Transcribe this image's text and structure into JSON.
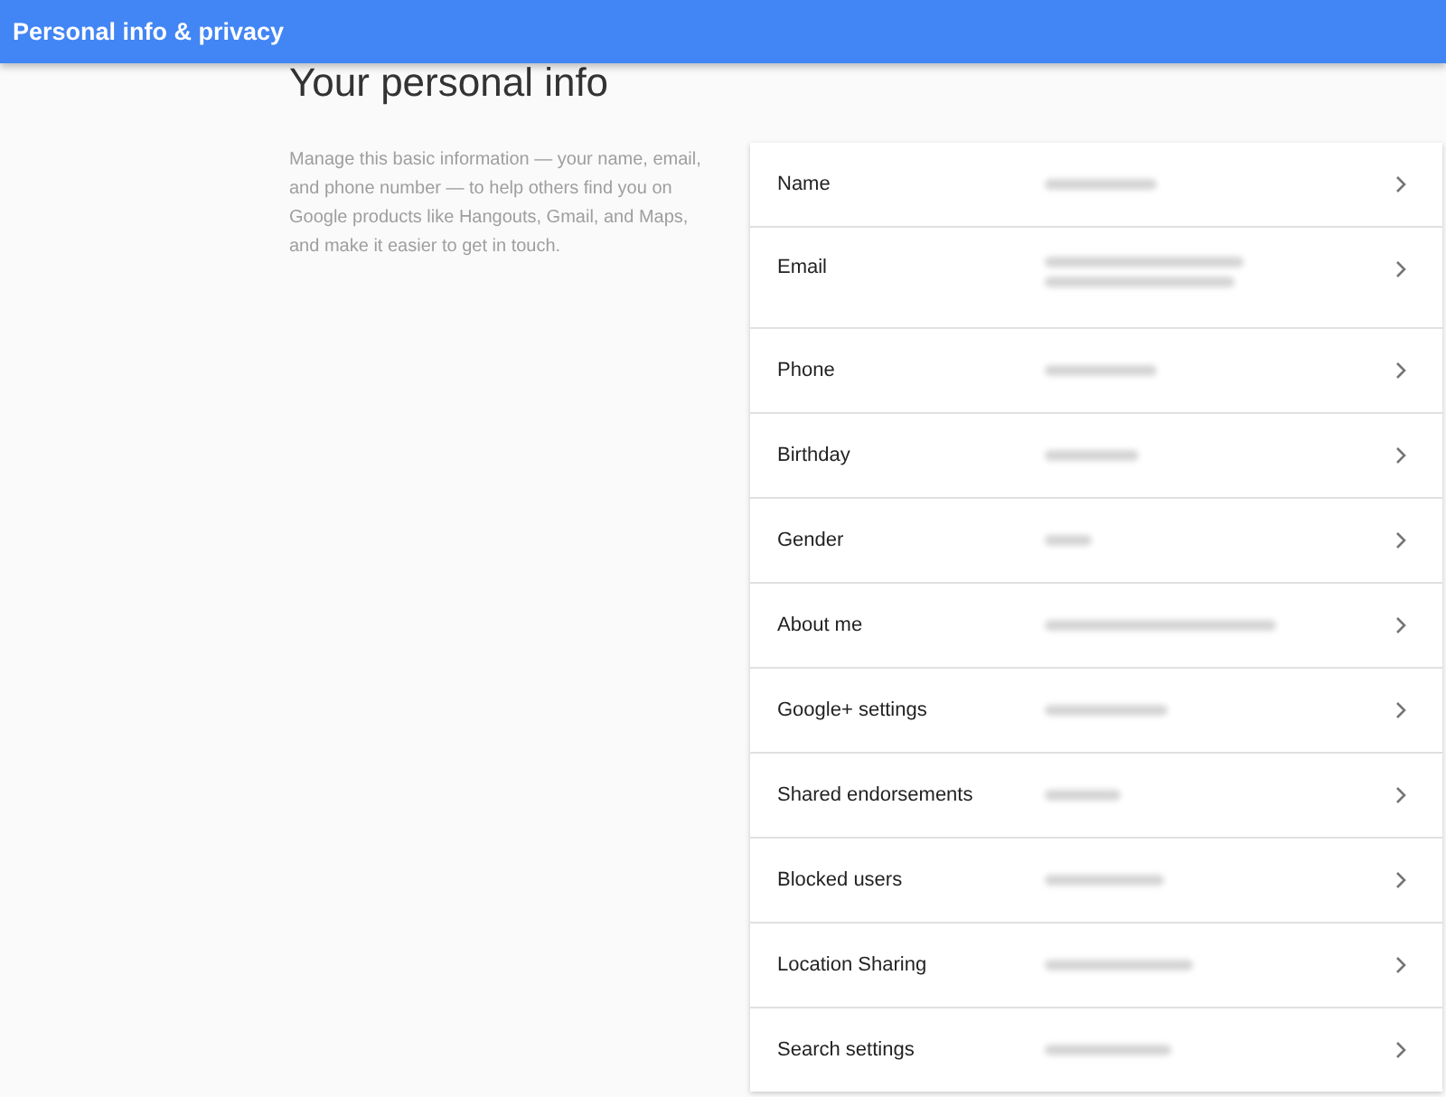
{
  "app_bar": {
    "title": "Personal info & privacy"
  },
  "heading": "Your personal info",
  "description": "Manage this basic information — your name, email, and phone number — to help others find you on Google products like Hangouts, Gmail, and Maps, and make it easier to get in touch.",
  "rows": [
    {
      "label": "Name",
      "kind": "single"
    },
    {
      "label": "Email",
      "kind": "double"
    },
    {
      "label": "Phone",
      "kind": "single"
    },
    {
      "label": "Birthday",
      "kind": "single"
    },
    {
      "label": "Gender",
      "kind": "single"
    },
    {
      "label": "About me",
      "kind": "single"
    },
    {
      "label": "Google+ settings",
      "kind": "single"
    },
    {
      "label": "Shared endorsements",
      "kind": "single"
    },
    {
      "label": "Blocked users",
      "kind": "single"
    },
    {
      "label": "Location Sharing",
      "kind": "single"
    },
    {
      "label": "Search settings",
      "kind": "single"
    }
  ]
}
